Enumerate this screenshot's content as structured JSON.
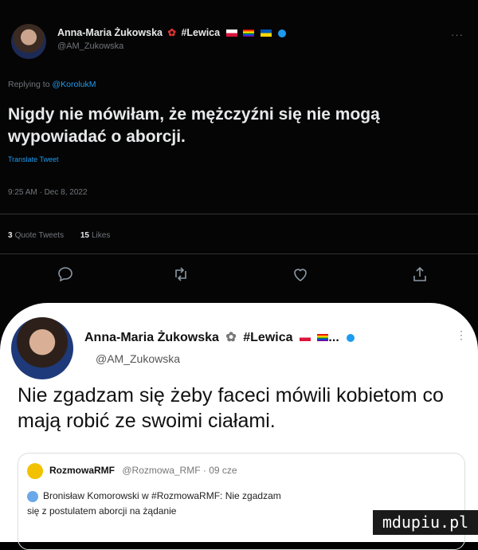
{
  "original_tweet": {
    "author_name": "Anna-Maria Żukowska",
    "author_tag": "#Lewica",
    "handle": "@AM_Zukowska",
    "more": "···",
    "replying_prefix": "Replying to",
    "replying_to": "@KorolukM",
    "text": "Nigdy nie mówiłam, że mężczyźni się nie mogą wypowiadać o aborcji.",
    "translate": "Translate Tweet",
    "timestamp": "9:25 AM · Dec 8, 2022",
    "quote_count": "3",
    "quote_label": "Quote Tweets",
    "likes_count": "15",
    "likes_label": "Likes",
    "actions": [
      "reply-icon",
      "retweet-icon",
      "like-icon",
      "share-icon"
    ]
  },
  "reply_tweet": {
    "author_name": "Anna-Maria Żukowska",
    "author_tag": "#Lewica",
    "flags_suffix": "...",
    "handle": "@AM_Zukowska",
    "more": "⋮",
    "text": "Nie zgadzam się żeby faceci mówili kobietom co mają robić ze swoimi ciałami."
  },
  "quoted": {
    "author_name": "RozmowaRMF",
    "author_meta": "@Rozmowa_RMF · 09 cze",
    "text_line1": "Bronisław Komorowski w #RozmowaRMF: Nie zgadzam",
    "text_line2": "się z postulatem aborcji na żądanie"
  },
  "watermark": "mdupiu.pl",
  "colors": {
    "accent": "#1d9bf0",
    "dark_bg": "#050505",
    "card_bg": "#ffffff"
  }
}
